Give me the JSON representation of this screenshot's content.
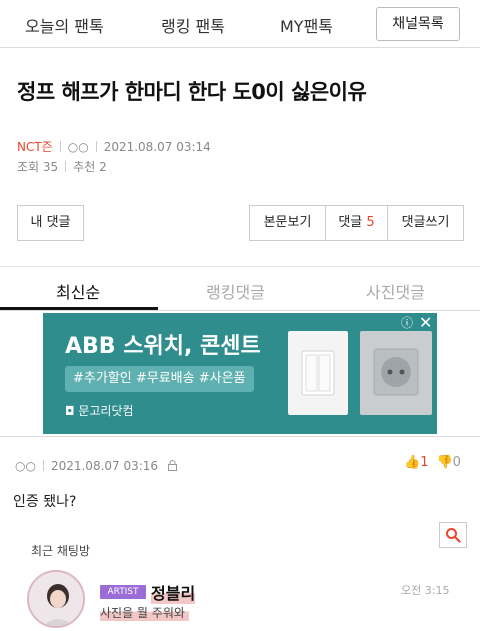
{
  "topnav": {
    "today": "오늘의 팬톡",
    "ranking": "랭킹 팬톡",
    "my": "MY팬톡",
    "channel_list": "채널목록"
  },
  "post": {
    "title": "정프 해프가 한마디 한다 도0이 싫은이유",
    "author": "NCT즌",
    "author_mark": "○○",
    "datetime": "2021.08.07 03:14",
    "views": "조회 35",
    "recommends": "추천 2"
  },
  "buttons": {
    "my_comments": "내 댓글",
    "view_body": "본문보기",
    "comments_label": "댓글",
    "comments_count": "5",
    "write_comment": "댓글쓰기"
  },
  "tabs": {
    "latest": "최신순",
    "ranking": "랭킹댓글",
    "photo": "사진댓글"
  },
  "ad": {
    "title": "ABB 스위치, 콘센트",
    "tags": "#추가할인 #무료배송 #사은품",
    "brand": "문고리닷컴"
  },
  "comment": {
    "author_mark": "○○",
    "datetime": "2021.08.07 03:16",
    "likes": "1",
    "dislikes": "0",
    "body": "인증 됐나?"
  },
  "chat": {
    "title": "최근 채팅방",
    "badge": "ARTIST",
    "name": "정블리",
    "message": "사진을 뭘 주워와",
    "time": "오전 3:15"
  },
  "colors": {
    "accent": "#e8472c",
    "ad_bg": "#2f8d8e",
    "artist_badge": "#9b6bd6"
  }
}
